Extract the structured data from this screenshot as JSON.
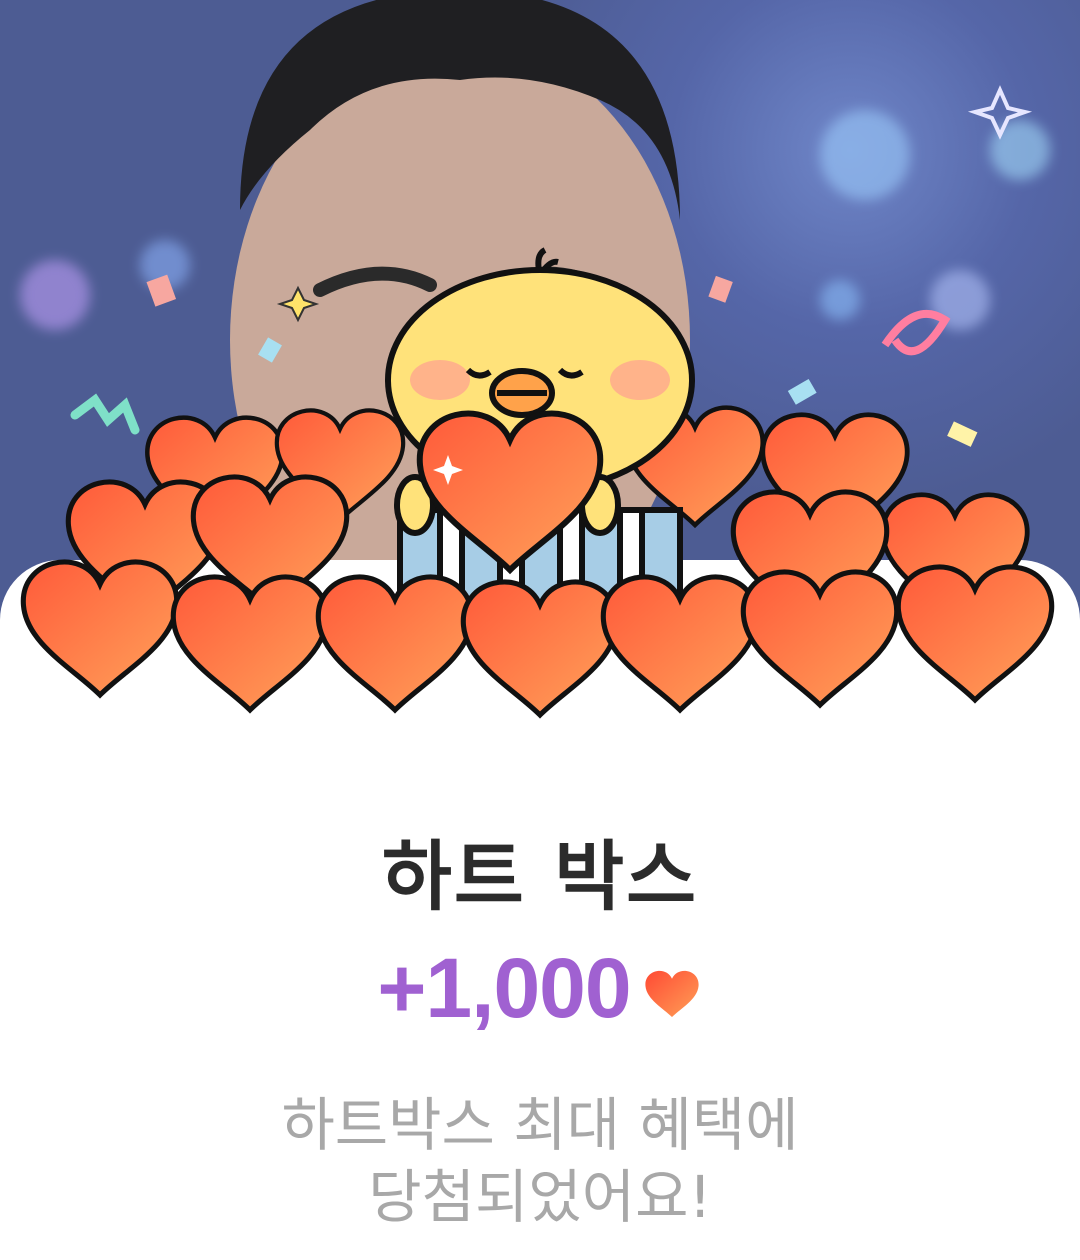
{
  "reward": {
    "title": "하트 박스",
    "amount": "+1,000",
    "message_line1": "하트박스 최대 혜택에",
    "message_line2": "당첨되었어요!",
    "currency_icon": "heart-icon"
  },
  "colors": {
    "amount": "#a061d1",
    "title": "#2b2b2b",
    "message": "#a8a8a8",
    "heart": "#ff6a3d",
    "heart_light": "#ff9a55",
    "chick": "#ffd95a",
    "background": "#4d5c93"
  }
}
